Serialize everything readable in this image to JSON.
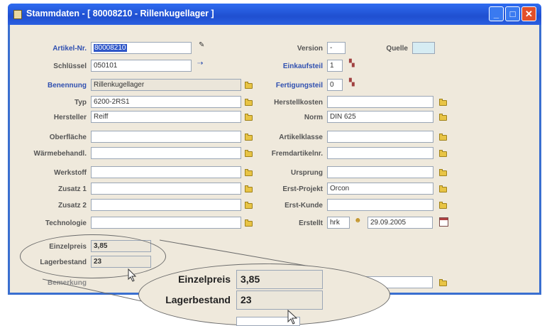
{
  "window": {
    "title": "Stammdaten - [ 80008210 - Rillenkugellager ]"
  },
  "left": {
    "artikel_nr": {
      "label": "Artikel-Nr.",
      "value": "80008210"
    },
    "schluessel": {
      "label": "Schlüssel",
      "value": "050101"
    },
    "benennung": {
      "label": "Benennung",
      "value": "Rillenkugellager"
    },
    "typ": {
      "label": "Typ",
      "value": "6200-2RS1"
    },
    "hersteller": {
      "label": "Hersteller",
      "value": "Reiff"
    },
    "oberflaeche": {
      "label": "Oberfläche",
      "value": ""
    },
    "waermebehandl": {
      "label": "Wärmebehandl.",
      "value": ""
    },
    "werkstoff": {
      "label": "Werkstoff",
      "value": ""
    },
    "zusatz1": {
      "label": "Zusatz 1",
      "value": ""
    },
    "zusatz2": {
      "label": "Zusatz 2",
      "value": ""
    },
    "technologie": {
      "label": "Technologie",
      "value": ""
    },
    "einzelpreis": {
      "label": "Einzelpreis",
      "value": "3,85"
    },
    "lagerbestand": {
      "label": "Lagerbestand",
      "value": "23"
    },
    "bemerkung": {
      "label": "Bemerkung"
    }
  },
  "right": {
    "version": {
      "label": "Version",
      "value": "-"
    },
    "quelle": {
      "label": "Quelle",
      "value": ""
    },
    "einkaufsteil": {
      "label": "Einkaufsteil",
      "value": "1"
    },
    "fertigungsteil": {
      "label": "Fertigungsteil",
      "value": "0"
    },
    "herstellkosten": {
      "label": "Herstellkosten",
      "value": ""
    },
    "norm": {
      "label": "Norm",
      "value": "DIN 625"
    },
    "artikelklasse": {
      "label": "Artikelklasse",
      "value": ""
    },
    "fremdartikelnr": {
      "label": "Fremdartikelnr.",
      "value": ""
    },
    "ursprung": {
      "label": "Ursprung",
      "value": ""
    },
    "erst_projekt": {
      "label": "Erst-Projekt",
      "value": "Orcon"
    },
    "erst_kunde": {
      "label": "Erst-Kunde",
      "value": ""
    },
    "erstellt": {
      "label": "Erstellt",
      "user": "hrk",
      "date": "29.09.2005"
    }
  },
  "colors": {
    "accent": "#2f6cf0",
    "close": "#e2502a",
    "background": "#efe9dc"
  },
  "icons": [
    "folder-icon",
    "lookup-icon",
    "calendar-icon",
    "cursor-icon"
  ]
}
